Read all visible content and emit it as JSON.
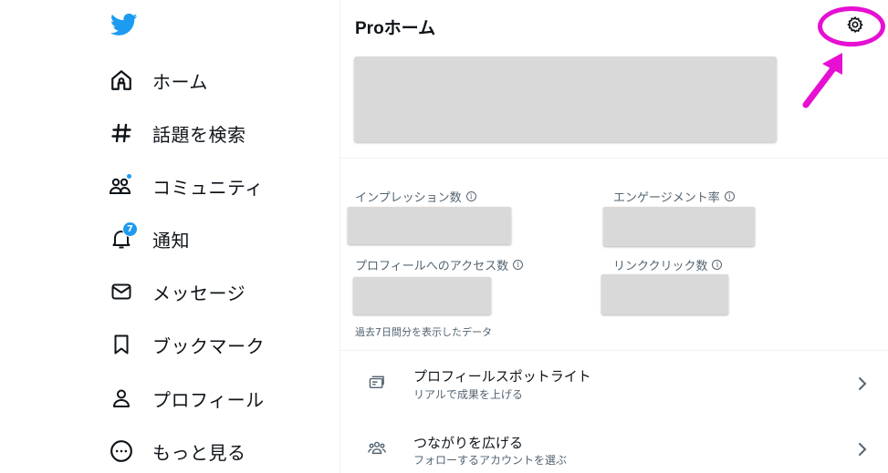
{
  "sidebar": {
    "logo_icon": "twitter-bird-icon",
    "items": [
      {
        "label": "ホーム",
        "icon": "home-icon"
      },
      {
        "label": "話題を検索",
        "icon": "hashtag-icon"
      },
      {
        "label": "コミュニティ",
        "icon": "communities-icon",
        "has_dot": true
      },
      {
        "label": "通知",
        "icon": "bell-icon",
        "badge": "7"
      },
      {
        "label": "メッセージ",
        "icon": "envelope-icon"
      },
      {
        "label": "ブックマーク",
        "icon": "bookmark-icon"
      },
      {
        "label": "プロフィール",
        "icon": "person-icon"
      },
      {
        "label": "もっと見る",
        "icon": "more-circle-icon"
      }
    ]
  },
  "main": {
    "title": "Proホーム",
    "settings_icon": "gear-icon",
    "metrics": [
      {
        "label": "インプレッション数"
      },
      {
        "label": "エンゲージメント率"
      },
      {
        "label": "プロフィールへのアクセス数"
      },
      {
        "label": "リンククリック数"
      }
    ],
    "info_glyph": "i",
    "footnote": "過去7日間分を表示したデータ",
    "rows": [
      {
        "title": "プロフィールスポットライト",
        "subtitle": "リアルで成果を上げる",
        "icon": "spotlight-card-icon"
      },
      {
        "title": "つながりを広げる",
        "subtitle": "フォローするアカウントを選ぶ",
        "icon": "people-group-icon"
      }
    ]
  },
  "colors": {
    "accent": "#1d9bf0",
    "annotation": "#e60fd2",
    "placeholder": "#d9d9d9"
  }
}
